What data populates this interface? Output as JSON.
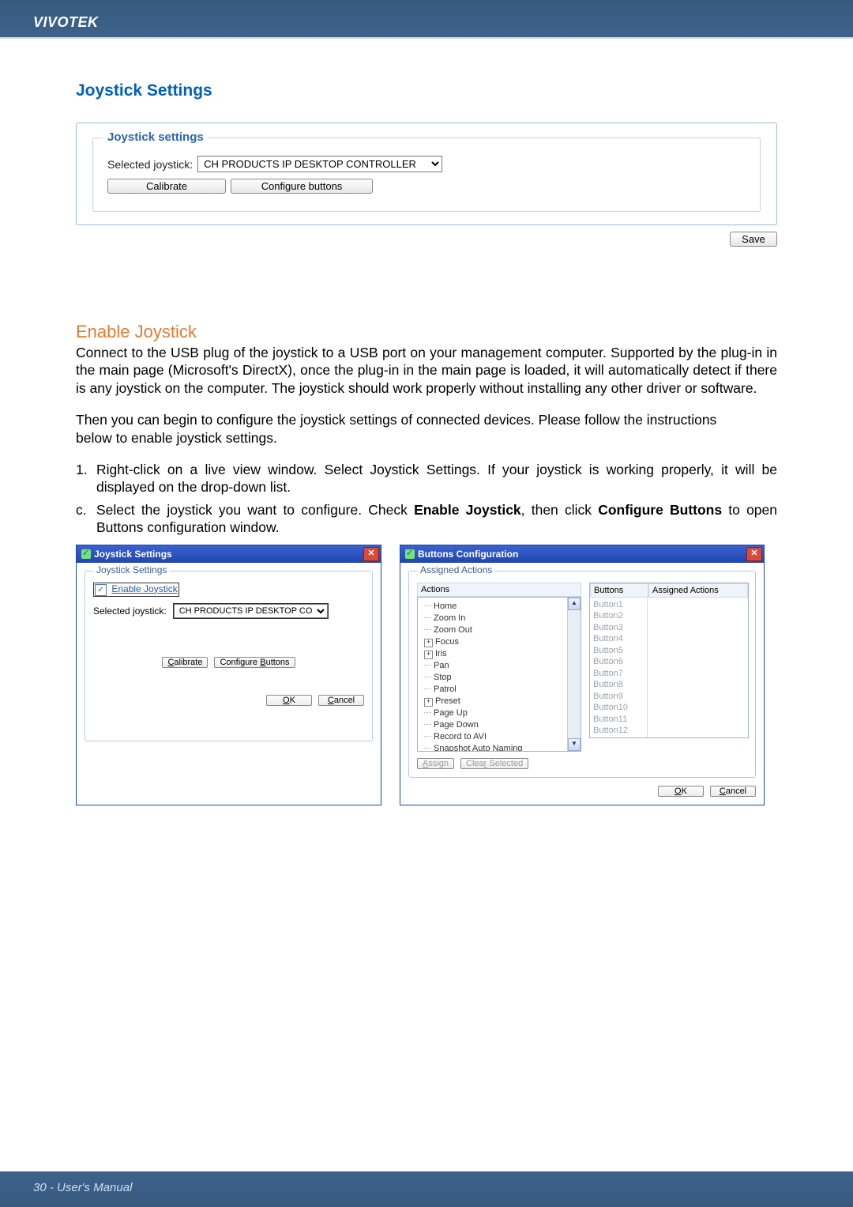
{
  "header": {
    "brand": "VIVOTEK"
  },
  "footer": {
    "text": "30 - User's Manual"
  },
  "title": "Joystick Settings",
  "panel1": {
    "legend": "Joystick settings",
    "selected_label": "Selected joystick:",
    "selected_value": "CH PRODUCTS IP DESKTOP CONTROLLER",
    "calibrate": "Calibrate",
    "configure": "Configure buttons",
    "save": "Save"
  },
  "enable": {
    "heading": "Enable Joystick",
    "p1": "Connect to the USB plug of the joystick to a USB port on your management computer. Supported by the plug-in in the main page (Microsoft's DirectX), once the plug-in in the main page is loaded, it will automatically detect if there is any joystick on the computer. The joystick should work properly without installing any other driver or software.",
    "p2": "Then you can begin to configure the joystick settings of connected devices. Please follow the instructions",
    "p2b": "below to enable joystick settings.",
    "steps": [
      {
        "num": "1.",
        "text": "Right-click on a live view window. Select Joystick Settings. If your joystick is working properly, it will be displayed on the drop-down list."
      },
      {
        "num": "c.",
        "prefix": "Select the joystick you want to configure. Check ",
        "bold1": "Enable Joystick",
        "mid": ", then click ",
        "bold2": "Configure Buttons",
        "suffix": " to open Buttons configuration window."
      }
    ]
  },
  "winA": {
    "title": "Joystick Settings",
    "legend": "Joystick Settings",
    "enable_label": "Enable Joystick",
    "selected_label": "Selected joystick:",
    "selected_value": "CH PRODUCTS IP DESKTOP CON",
    "calibrate_html": [
      "C",
      "alibrate"
    ],
    "configure_html": [
      "Configure ",
      "B",
      "uttons"
    ],
    "ok_html": [
      "O",
      "K"
    ],
    "cancel_html": [
      "C",
      "ancel"
    ]
  },
  "winB": {
    "title": "Buttons Configuration",
    "legend": "Assigned Actions",
    "actions_header": "Actions",
    "buttons_header": "Buttons",
    "assigned_header": "Assigned Actions",
    "tree": [
      {
        "t": "Home",
        "exp": ""
      },
      {
        "t": "Zoom In",
        "exp": ""
      },
      {
        "t": "Zoom Out",
        "exp": ""
      },
      {
        "t": "Focus",
        "exp": "+"
      },
      {
        "t": "Iris",
        "exp": "+"
      },
      {
        "t": "Pan",
        "exp": ""
      },
      {
        "t": "Stop",
        "exp": ""
      },
      {
        "t": "Patrol",
        "exp": ""
      },
      {
        "t": "Preset",
        "exp": "+"
      },
      {
        "t": "Page Up",
        "exp": ""
      },
      {
        "t": "Page Down",
        "exp": ""
      },
      {
        "t": "Record to AVI",
        "exp": ""
      },
      {
        "t": "Snapshot Auto Naming",
        "exp": ""
      }
    ],
    "buttons_list": [
      "Button1",
      "Button2",
      "Button3",
      "Button4",
      "Button5",
      "Button6",
      "Button7",
      "Button8",
      "Button9",
      "Button10",
      "Button11",
      "Button12"
    ],
    "assign_html": [
      "A",
      "ssign"
    ],
    "clear_html": [
      "Clea",
      "r",
      " Selected"
    ],
    "ok_html": [
      "O",
      "K"
    ],
    "cancel_html": [
      "C",
      "ancel"
    ]
  }
}
